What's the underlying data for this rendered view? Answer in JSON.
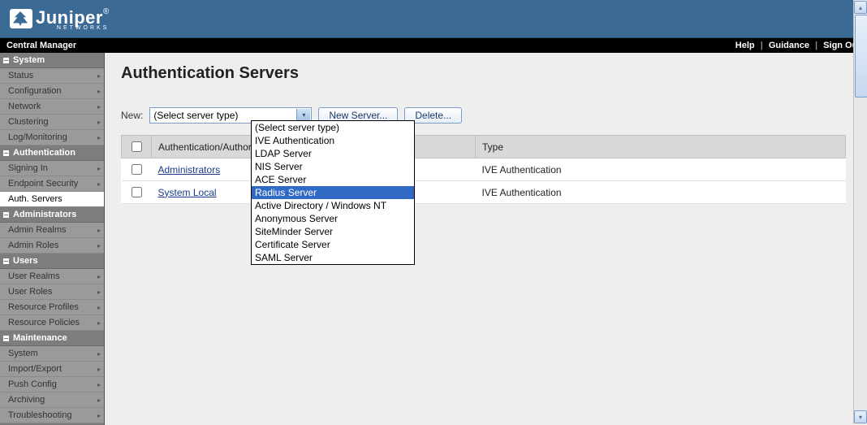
{
  "brand": {
    "name": "Juniper",
    "sub": "NETWORKS"
  },
  "utilbar": {
    "left": "Central Manager",
    "links": {
      "help": "Help",
      "guidance": "Guidance",
      "signout": "Sign Out"
    }
  },
  "sidebar": {
    "groups": [
      {
        "label": "System",
        "items": [
          {
            "label": "Status"
          },
          {
            "label": "Configuration"
          },
          {
            "label": "Network"
          },
          {
            "label": "Clustering"
          },
          {
            "label": "Log/Monitoring"
          }
        ]
      },
      {
        "label": "Authentication",
        "items": [
          {
            "label": "Signing In"
          },
          {
            "label": "Endpoint Security"
          },
          {
            "label": "Auth. Servers",
            "active": true
          }
        ]
      },
      {
        "label": "Administrators",
        "items": [
          {
            "label": "Admin Realms"
          },
          {
            "label": "Admin Roles"
          }
        ]
      },
      {
        "label": "Users",
        "items": [
          {
            "label": "User Realms"
          },
          {
            "label": "User Roles"
          },
          {
            "label": "Resource Profiles"
          },
          {
            "label": "Resource Policies"
          }
        ]
      },
      {
        "label": "Maintenance",
        "items": [
          {
            "label": "System"
          },
          {
            "label": "Import/Export"
          },
          {
            "label": "Push Config"
          },
          {
            "label": "Archiving"
          },
          {
            "label": "Troubleshooting"
          }
        ]
      }
    ]
  },
  "page": {
    "title": "Authentication Servers",
    "new_label": "New:",
    "select_placeholder": "(Select server type)",
    "new_server_btn": "New Server...",
    "delete_btn": "Delete..."
  },
  "dropdown_options": [
    "(Select server type)",
    "IVE Authentication",
    "LDAP Server",
    "NIS Server",
    "ACE Server",
    "Radius Server",
    "Active Directory / Windows NT",
    "Anonymous Server",
    "SiteMinder Server",
    "Certificate Server",
    "SAML Server"
  ],
  "dropdown_highlight": "Radius Server",
  "table": {
    "headers": {
      "servers": "Authentication/Authorization Servers",
      "type": "Type"
    },
    "rows": [
      {
        "name": "Administrators",
        "type": "IVE Authentication"
      },
      {
        "name": "System Local",
        "type": "IVE Authentication"
      }
    ]
  }
}
